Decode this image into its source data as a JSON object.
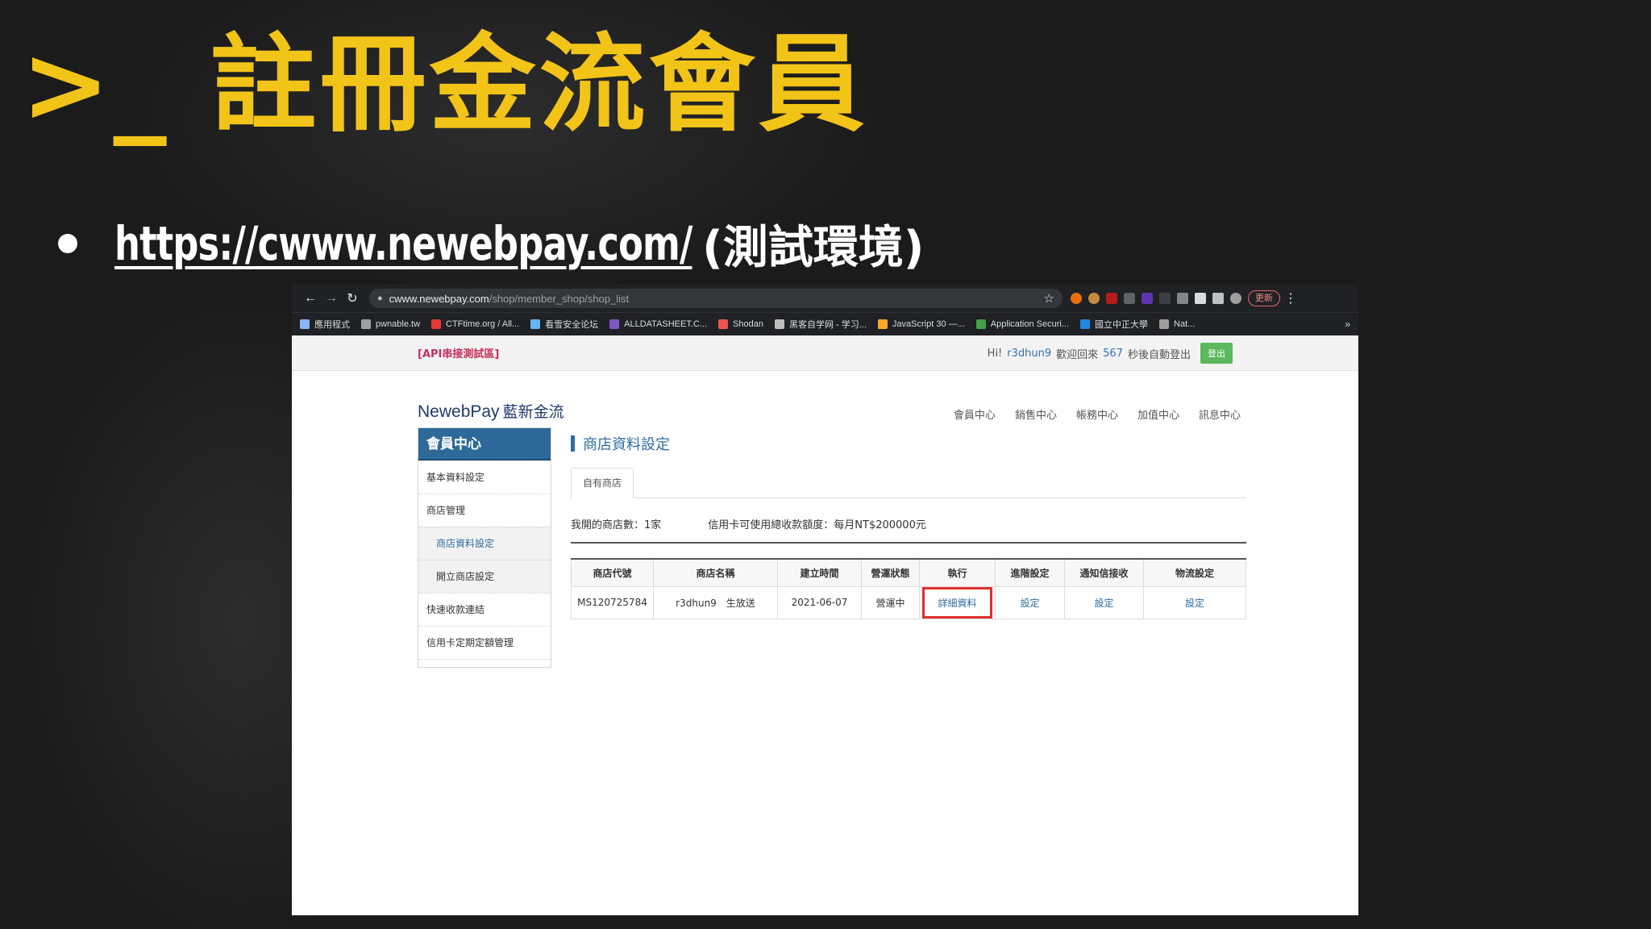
{
  "slide": {
    "title": ">_ 註冊金流會員",
    "bullet_link": "https://cwww.newebpay.com/",
    "bullet_note": "(測試環境)"
  },
  "browser": {
    "url_host": "cwww.newebpay.com",
    "url_path": "/shop/member_shop/shop_list",
    "update_label": "更新",
    "bookmarks": [
      {
        "label": "應用程式",
        "color": "#8ab4f8"
      },
      {
        "label": "pwnable.tw",
        "color": "#9aa0a6"
      },
      {
        "label": "CTFtime.org / All...",
        "color": "#e53935"
      },
      {
        "label": "看雪安全论坛",
        "color": "#64b5f6"
      },
      {
        "label": "ALLDATASHEET.C...",
        "color": "#7e57c2"
      },
      {
        "label": "Shodan",
        "color": "#ef5350"
      },
      {
        "label": "黑客自学网 - 学习...",
        "color": "#bdbdbd"
      },
      {
        "label": "JavaScript 30 —...",
        "color": "#f9a825"
      },
      {
        "label": "Application Securi...",
        "color": "#43a047"
      },
      {
        "label": "國立中正大學",
        "color": "#1e88e5"
      },
      {
        "label": "Nat...",
        "color": "#9e9e9e"
      }
    ],
    "bookmarks_more": "»"
  },
  "page": {
    "api_tag": "[API串接測試區]",
    "greeting_prefix": "Hi!",
    "username": "r3dhun9",
    "greeting_mid": "歡迎回來",
    "countdown": "567",
    "greeting_suffix": "秒後自動登出",
    "logout_label": "登出",
    "logo_en": "NewebPay",
    "logo_cn": "藍新金流",
    "main_nav": [
      "會員中心",
      "銷售中心",
      "帳務中心",
      "加值中心",
      "訊息中心"
    ],
    "sidebar": {
      "heading": "會員中心",
      "items": [
        {
          "label": "基本資料設定",
          "sub": false,
          "active": false
        },
        {
          "label": "商店管理",
          "sub": false,
          "active": false
        },
        {
          "label": "商店資料設定",
          "sub": true,
          "active": true
        },
        {
          "label": "開立商店設定",
          "sub": true,
          "active": false
        },
        {
          "label": "快速收款連結",
          "sub": false,
          "active": false
        },
        {
          "label": "信用卡定期定額管理",
          "sub": false,
          "active": false
        }
      ]
    },
    "section_title": "商店資料設定",
    "tab_label": "自有商店",
    "shop_count": "我開的商店數：1家",
    "credit_cap": "信用卡可使用總收款額度：每月NT$200000元",
    "table": {
      "headers": [
        "商店代號",
        "商店名稱",
        "建立時間",
        "營運狀態",
        "執行",
        "進階設定",
        "通知信接收",
        "物流設定"
      ],
      "row": {
        "shop_id": "MS120725784",
        "shop_name": "r3dhun9　生放送",
        "created": "2021-06-07",
        "status": "營運中",
        "detail_link": "詳細資料",
        "advanced_link": "設定",
        "notify_link": "設定",
        "logistics_link": "設定"
      }
    }
  }
}
